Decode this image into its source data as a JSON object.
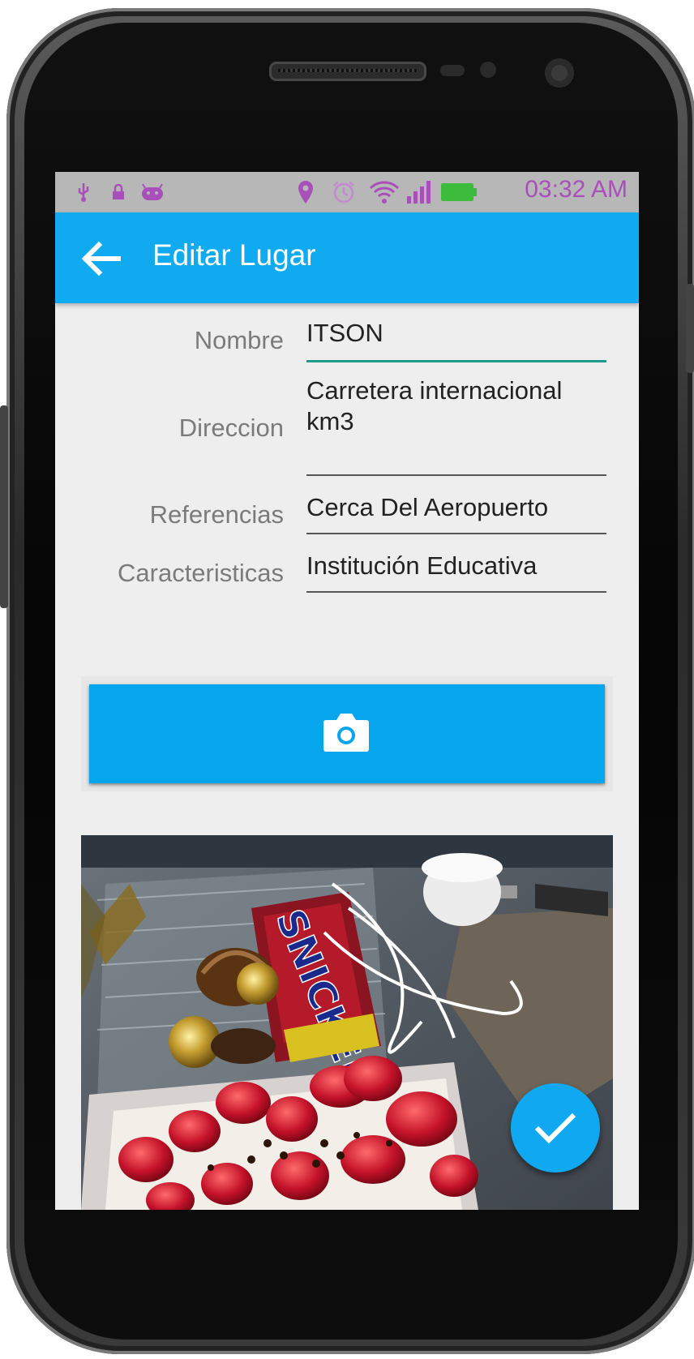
{
  "statusbar": {
    "time": "03:32 AM",
    "icons": [
      "usb-icon",
      "lock-icon",
      "android-icon",
      "location-icon",
      "alarm-icon",
      "wifi-icon",
      "signal-icon",
      "battery-icon"
    ]
  },
  "appbar": {
    "title": "Editar Lugar",
    "back_icon": "arrow-back-icon"
  },
  "form": {
    "nombre": {
      "label": "Nombre",
      "value": "ITSON"
    },
    "direccion": {
      "label": "Direccion",
      "value_line1": "Carretera internacional",
      "value_line2": "km3"
    },
    "referencias": {
      "label": "Referencias",
      "value": "Cerca Del Aeropuerto"
    },
    "caracteristicas": {
      "label": "Caracteristicas",
      "value": "Institución Educativa"
    }
  },
  "photo_button": {
    "icon": "camera-icon"
  },
  "photo": {
    "brand_text": "SNICKERS"
  },
  "fab": {
    "icon": "check-icon"
  },
  "colors": {
    "appbar": "#10aaf0",
    "statusbar": "#b7b7b7",
    "status_icons": "#a94fb9",
    "active_underline": "#1e9a8a"
  }
}
